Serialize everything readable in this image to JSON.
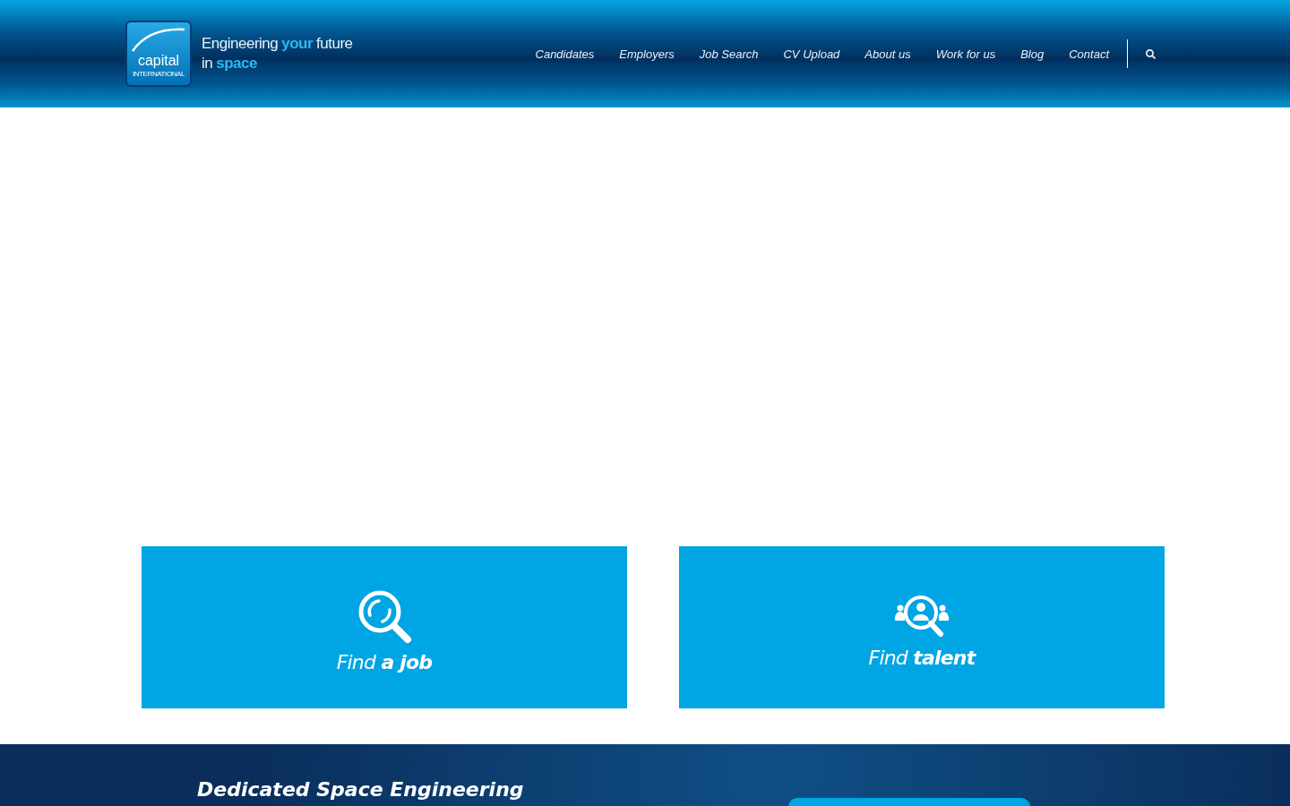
{
  "header": {
    "logo": {
      "name": "capital",
      "sub": "INTERNATIONAL"
    },
    "tagline": [
      [
        {
          "text": "Engineering",
          "highlight": false
        },
        {
          "text": "your",
          "highlight": true
        },
        {
          "text": "future",
          "highlight": false
        }
      ],
      [
        {
          "text": "in",
          "highlight": false
        },
        {
          "text": "space",
          "highlight": true
        }
      ]
    ],
    "nav": [
      "Candidates",
      "Employers",
      "Job Search",
      "CV Upload",
      "About us",
      "Work for us",
      "Blog",
      "Contact"
    ]
  },
  "cards": [
    {
      "label": "Find **a job**",
      "kind": "job"
    },
    {
      "label": "Find **talent**",
      "kind": "talent"
    }
  ],
  "banner": {
    "heading": "Dedicated Space Engineering"
  }
}
